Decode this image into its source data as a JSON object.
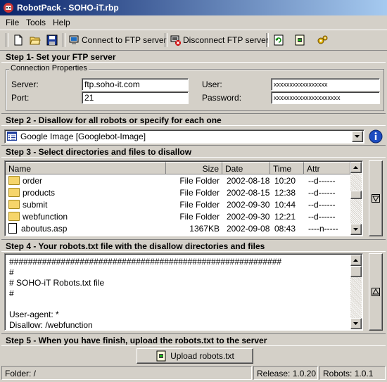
{
  "window": {
    "title": "RobotPack - SOHO-iT.rbp"
  },
  "menu": [
    "File",
    "Tools",
    "Help"
  ],
  "toolbar": {
    "connect_label": "Connect to FTP server",
    "disconnect_label": "Disconnect FTP server"
  },
  "step1": {
    "header": "Step 1- Set your FTP server",
    "group_title": "Connection Properties",
    "server_label": "Server:",
    "server_value": "ftp.soho-it.com",
    "port_label": "Port:",
    "port_value": "21",
    "user_label": "User:",
    "user_value": "xxxxxxxxxxxxxxxxx",
    "password_label": "Password:",
    "password_value": "xxxxxxxxxxxxxxxxxxxxx"
  },
  "step2": {
    "header": "Step 2 - Disallow for all robots or specify for each one",
    "selected_robot": "Google Image [Googlebot-Image]"
  },
  "step3": {
    "header": "Step 3 - Select directories and files to disallow",
    "columns": [
      "Name",
      "Size",
      "Date",
      "Time",
      "Attr"
    ],
    "rows": [
      {
        "type": "folder",
        "name": "order",
        "size": "File Folder",
        "date": "2002-08-18",
        "time": "10:20",
        "attr": "--d------"
      },
      {
        "type": "folder",
        "name": "products",
        "size": "File Folder",
        "date": "2002-08-15",
        "time": "12:38",
        "attr": "--d------"
      },
      {
        "type": "folder",
        "name": "submit",
        "size": "File Folder",
        "date": "2002-09-30",
        "time": "10:44",
        "attr": "--d------"
      },
      {
        "type": "folder",
        "name": "webfunction",
        "size": "File Folder",
        "date": "2002-09-30",
        "time": "12:21",
        "attr": "--d------"
      },
      {
        "type": "file",
        "name": "aboutus.asp",
        "size": "1367KB",
        "date": "2002-09-08",
        "time": "08:43",
        "attr": "----n-----"
      }
    ]
  },
  "step4": {
    "header": "Step 4 - Your robots.txt file with the disallow directories and files",
    "lines": [
      "##########################################################",
      "#",
      "# SOHO-iT Robots.txt file",
      "#",
      "",
      "User-agent: *",
      "Disallow: /webfunction"
    ]
  },
  "step5": {
    "header": "Step 5 - When you have finish, upload the robots.txt to the server",
    "upload_label": "Upload robots.txt"
  },
  "status": {
    "folder": "Folder: /",
    "release": "Release: 1.0.20",
    "robots": "Robots: 1.0.1"
  }
}
